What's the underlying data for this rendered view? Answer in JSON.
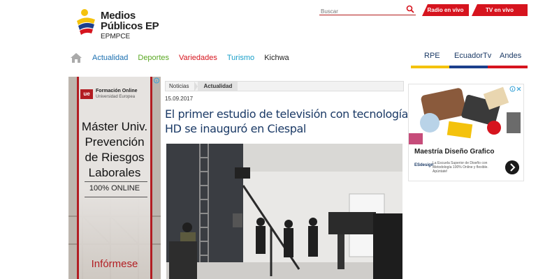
{
  "header": {
    "logo_line1": "Medios",
    "logo_line2": "Públicos EP",
    "logo_sub": "EPMPCE",
    "search_placeholder": "Buscar",
    "radio_label": "Radio en vivo",
    "tv_label": "TV en vivo"
  },
  "nav": {
    "items": [
      {
        "label": "Actualidad",
        "color": "#1b6fb0"
      },
      {
        "label": "Deportes",
        "color": "#5aa823"
      },
      {
        "label": "Variedades",
        "color": "#d6141e"
      },
      {
        "label": "Turismo",
        "color": "#1aa0c9"
      },
      {
        "label": "Kichwa",
        "color": "#222222"
      }
    ],
    "right": [
      "RPE",
      "EcuadorTv",
      "Andes"
    ]
  },
  "ad_left": {
    "brand1": "Formación Online",
    "brand2": "Universidad Europea",
    "logo": "ue",
    "lines": [
      "Máster Univ.",
      "Prevención",
      "de Riesgos",
      "Laborales"
    ],
    "online": "100% ONLINE",
    "cta": "Infórmese"
  },
  "article": {
    "breadcrumb": [
      "Noticias",
      "Actualidad"
    ],
    "date": "15.09.2017",
    "title": "El primer estudio de televisión con tecnología HD se inauguró en Ciespal"
  },
  "ad_right": {
    "title": "Maestría Diseño Grafico",
    "logo": "ESdesign",
    "desc": "La Escuela Superior de Diseño con Metodología 100% Online y flexible. Apúntate!"
  },
  "colors": {
    "brand_red": "#d6141e",
    "title_blue": "#1b3a66",
    "flag_yellow": "#f4c20d",
    "flag_blue": "#1c3f8c"
  }
}
